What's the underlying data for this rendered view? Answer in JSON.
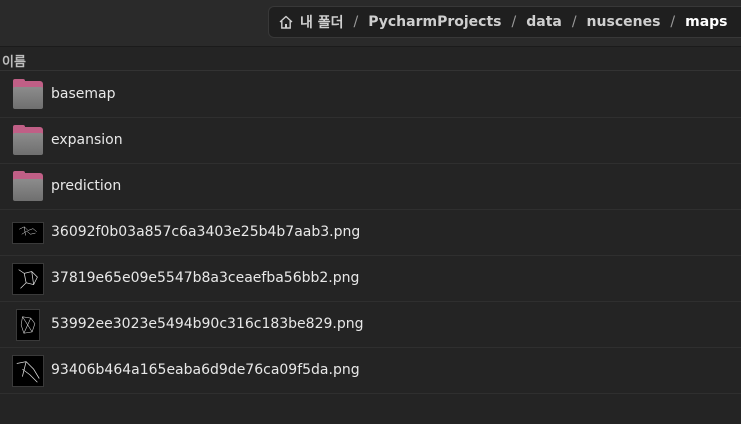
{
  "pathbar": {
    "items": [
      {
        "label": "내 폴더",
        "icon": "home-icon"
      },
      {
        "label": "PycharmProjects"
      },
      {
        "label": "data"
      },
      {
        "label": "nuscenes"
      },
      {
        "label": "maps"
      }
    ],
    "separator": "/"
  },
  "columns": {
    "name": "이름"
  },
  "files": [
    {
      "name": "basemap",
      "type": "folder"
    },
    {
      "name": "expansion",
      "type": "folder"
    },
    {
      "name": "prediction",
      "type": "folder"
    },
    {
      "name": "36092f0b03a857c6a3403e25b4b7aab3.png",
      "type": "image"
    },
    {
      "name": "37819e65e09e5547b8a3ceaefba56bb2.png",
      "type": "image"
    },
    {
      "name": "53992ee3023e5494b90c316c183be829.png",
      "type": "image"
    },
    {
      "name": "93406b464a165eaba6d9de76ca09f5da.png",
      "type": "image"
    }
  ],
  "colors": {
    "folder_back": "#c05f86",
    "folder_front": "#7d7d7d",
    "background": "#242424"
  }
}
